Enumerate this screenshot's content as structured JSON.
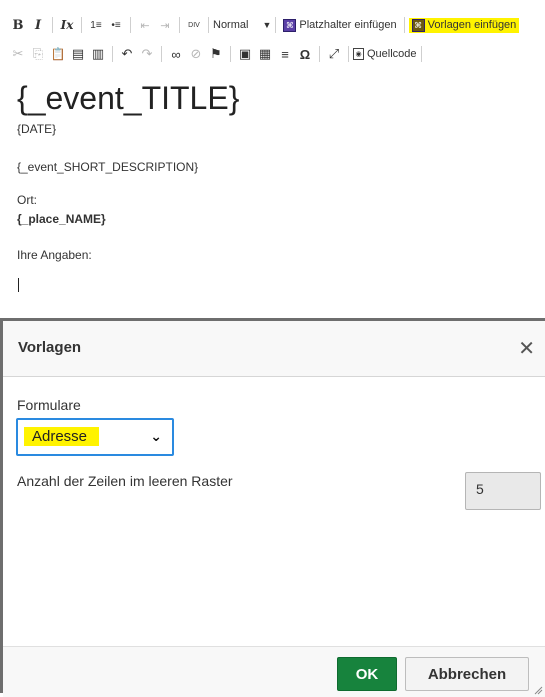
{
  "toolbar": {
    "row1": {
      "bold": "B",
      "italic": "I",
      "clear_format": "Ix",
      "numbered_list": "1≡",
      "bulleted_list": "•≡",
      "outdent": "⇤",
      "indent": "⇥",
      "div": "DIV",
      "format_value": "Normal",
      "placeholder_label": "Platzhalter einfügen",
      "templates_label": "Vorlagen einfügen"
    },
    "row2": {
      "cut": "✂",
      "copy": "⎘",
      "paste": "📋",
      "paste_text": "▤",
      "paste_word": "▥",
      "undo": "↶",
      "redo": "↷",
      "link": "∞",
      "unlink": "⊘",
      "anchor": "⚑",
      "image": "▣",
      "table": "▦",
      "hline": "≡",
      "special_char": "Ω",
      "maximize": "⤢",
      "source_label": "Quellcode"
    },
    "highlight_color": "#fff300"
  },
  "document": {
    "title": "{_event_TITLE}",
    "date": "{DATE}",
    "short_description": "{_event_SHORT_DESCRIPTION}",
    "ort_label": "Ort:",
    "place": "{_place_NAME}",
    "angaben": "Ihre Angaben:"
  },
  "dialog": {
    "title": "Vorlagen",
    "close": "✕",
    "form_label": "Formulare",
    "form_selected": "Adresse",
    "rows_label": "Anzahl der Zeilen im leeren Raster",
    "rows_value": "5",
    "ok_label": "OK",
    "cancel_label": "Abbrechen",
    "ok_color": "#17833d"
  }
}
